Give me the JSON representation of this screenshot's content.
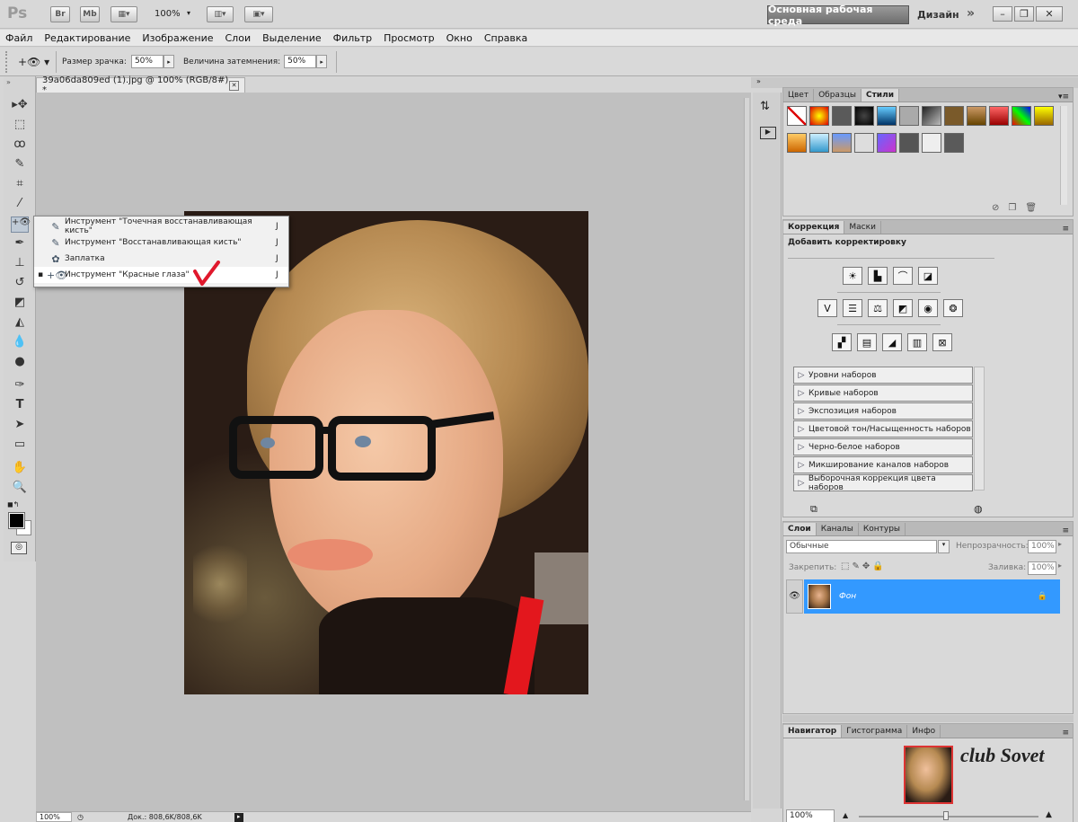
{
  "app": {
    "logo": "Ps",
    "bridge": "Br",
    "minibridge": "Mb",
    "zoom": "100%",
    "workspace": "Основная рабочая среда",
    "design": "Дизайн",
    "more": "»",
    "min": "–",
    "restore": "❐",
    "close": "✕"
  },
  "menu": [
    "Файл",
    "Редактирование",
    "Изображение",
    "Слои",
    "Выделение",
    "Фильтр",
    "Просмотр",
    "Окно",
    "Справка"
  ],
  "options": {
    "pupil_label": "Размер зрачка:",
    "pupil_value": "50%",
    "darken_label": "Величина затемнения:",
    "darken_value": "50%"
  },
  "document": {
    "tab_title": "39a06da809ed (1).jpg @ 100% (RGB/8#) *",
    "tab_close": "✕"
  },
  "flyout": [
    {
      "label": "Инструмент \"Точечная восстанавливающая кисть\"",
      "shortcut": "J",
      "selected": false,
      "icon": "spot-healing-brush-icon"
    },
    {
      "label": "Инструмент \"Восстанавливающая кисть\"",
      "shortcut": "J",
      "selected": false,
      "icon": "healing-brush-icon"
    },
    {
      "label": "Заплатка",
      "shortcut": "J",
      "selected": false,
      "icon": "patch-icon"
    },
    {
      "label": "Инструмент \"Красные глаза\"",
      "shortcut": "J",
      "selected": true,
      "icon": "red-eye-icon"
    }
  ],
  "status": {
    "zoom": "100%",
    "doc": "Док.: 808,6K/808,6K"
  },
  "styles_panel": {
    "tabs": [
      "Цвет",
      "Образцы",
      "Стили"
    ],
    "active": "Стили"
  },
  "correction_panel": {
    "tabs": [
      "Коррекция",
      "Маски"
    ],
    "active": "Коррекция",
    "heading": "Добавить корректировку",
    "presets": [
      "Уровни наборов",
      "Кривые наборов",
      "Экспозиция наборов",
      "Цветовой тон/Насыщенность наборов",
      "Черно-белое наборов",
      "Микширование каналов наборов",
      "Выборочная коррекция цвета наборов"
    ]
  },
  "layers_panel": {
    "tabs": [
      "Слои",
      "Каналы",
      "Контуры"
    ],
    "active": "Слои",
    "blend": "Обычные",
    "opacity_label": "Непрозрачность:",
    "opacity_value": "100%",
    "lock_label": "Закрепить:",
    "fill_label": "Заливка:",
    "fill_value": "100%",
    "layer_name": "Фон"
  },
  "navigator_panel": {
    "tabs": [
      "Навигатор",
      "Гистограмма",
      "Инфо"
    ],
    "active": "Навигатор",
    "zoom": "100%"
  },
  "watermark": "club Sovet",
  "colors": {
    "accent": "#3399ff",
    "check": "#e0182c"
  }
}
